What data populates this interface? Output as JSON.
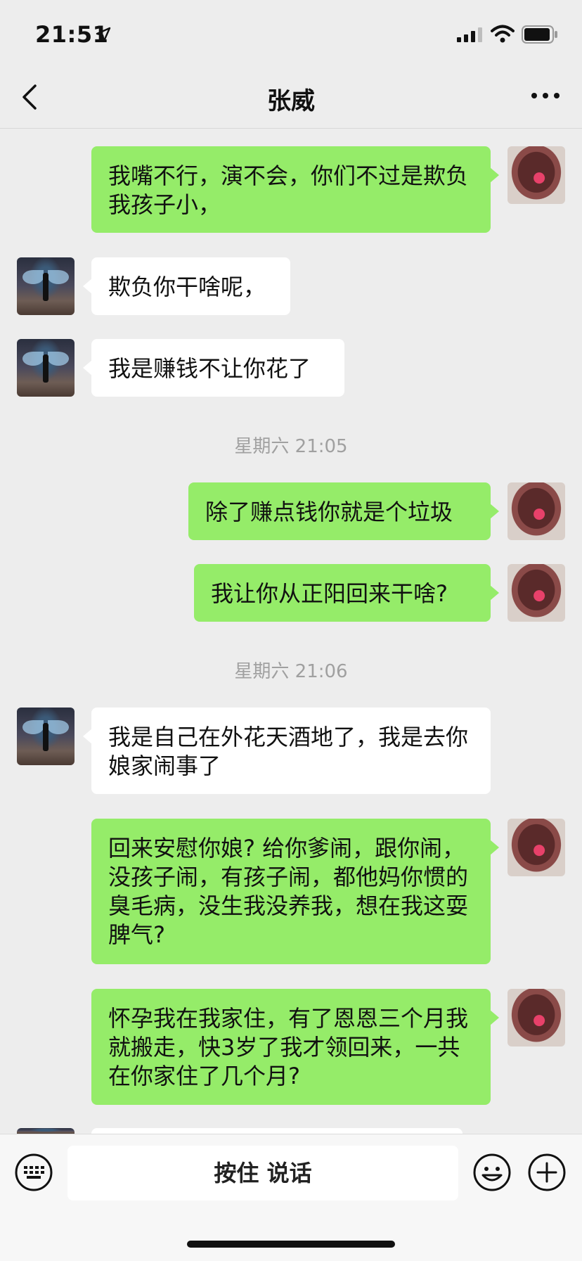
{
  "status_bar": {
    "time": "21:51"
  },
  "header": {
    "title": "张威"
  },
  "messages": [
    {
      "side": "sent",
      "text": "我嘴不行，演不会，你们不过是欺负我孩子小，"
    },
    {
      "side": "recv",
      "text": "欺负你干啥呢，"
    },
    {
      "side": "recv",
      "text": "我是赚钱不让你花了"
    },
    {
      "timestamp": "星期六 21:05"
    },
    {
      "side": "sent",
      "text": "除了赚点钱你就是个垃圾"
    },
    {
      "side": "sent",
      "text": "我让你从正阳回来干啥?"
    },
    {
      "timestamp": "星期六 21:06"
    },
    {
      "side": "recv",
      "text": "我是自己在外花天酒地了，我是去你娘家闹事了"
    },
    {
      "side": "sent",
      "text": "回来安慰你娘? 给你爹闹，跟你闹，没孩子闹，有孩子闹，都他妈你惯的臭毛病，没生我没养我，想在我这耍脾气?"
    },
    {
      "side": "sent",
      "text": "怀孕我在我家住，有了恩恩三个月我就搬走，快3岁了我才领回来，一共在你家住了几个月?"
    }
  ],
  "input_bar": {
    "voice_label": "按住 说话"
  },
  "icons": {
    "back": "chevron-left-icon",
    "more": "ellipsis-icon",
    "keyboard": "keyboard-icon",
    "emoji": "smiley-icon",
    "plus": "plus-circle-icon"
  },
  "colors": {
    "sent_bubble": "#95ec69",
    "recv_bubble": "#ffffff",
    "background": "#ededed"
  }
}
